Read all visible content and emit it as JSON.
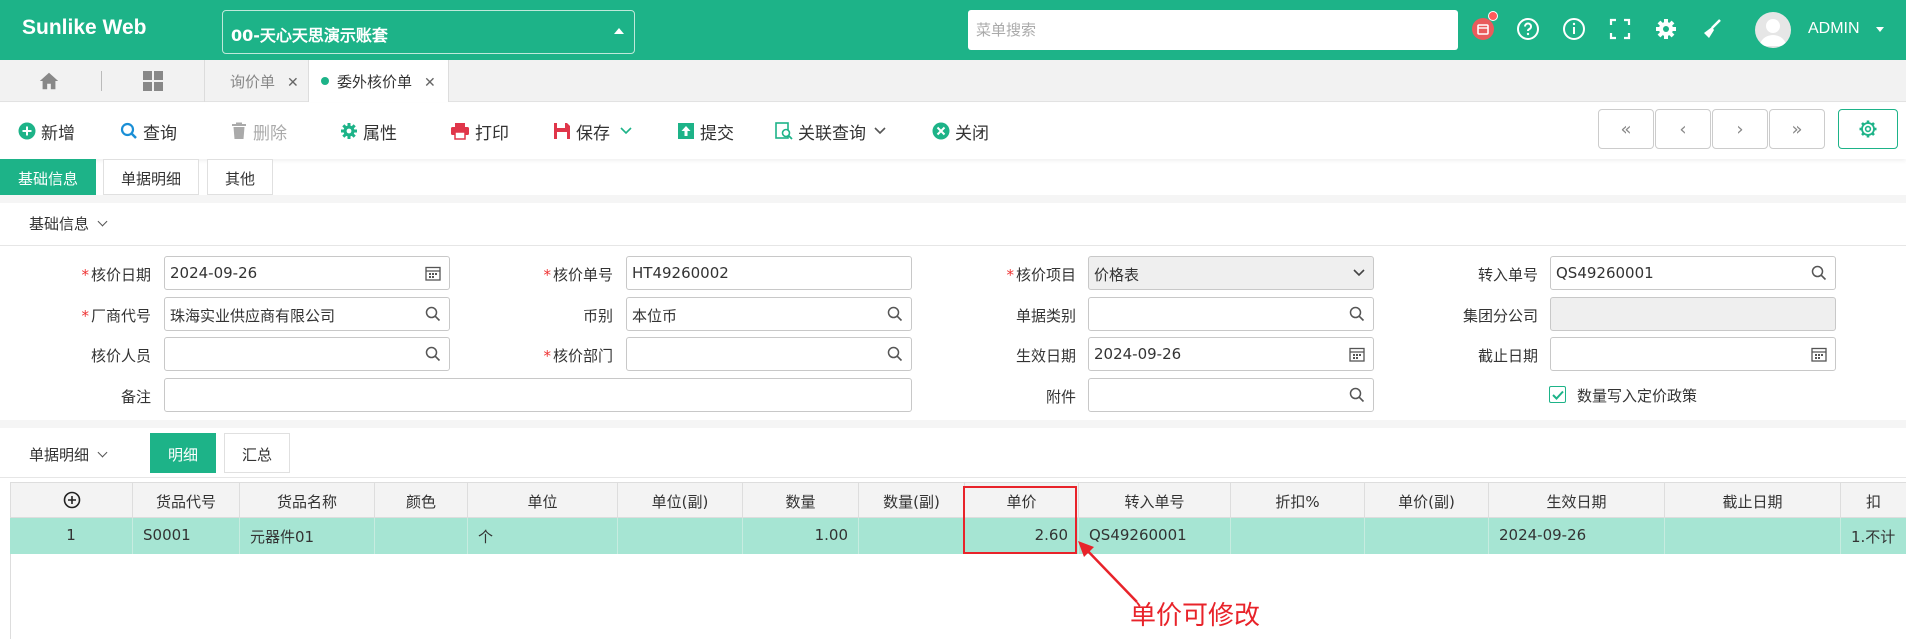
{
  "app": {
    "brand": "Sunlike Web",
    "account": "00-天心天思演示账套",
    "search_placeholder": "菜单搜索",
    "user": "ADMIN"
  },
  "colors": {
    "primary": "#1db388",
    "row_selected": "#a6e5d3",
    "annotation": "#e8232a"
  },
  "page_tabs": [
    {
      "label": "询价单",
      "active": false
    },
    {
      "label": "委外核价单",
      "active": true
    }
  ],
  "toolbar": {
    "add": "新增",
    "query": "查询",
    "delete": "删除",
    "properties": "属性",
    "print": "打印",
    "save": "保存",
    "submit": "提交",
    "related_query": "关联查询",
    "close": "关闭"
  },
  "form_tabs": [
    "基础信息",
    "单据明细",
    "其他"
  ],
  "basic_section_title": "基础信息",
  "fields": {
    "price_date": {
      "label": "核价日期",
      "value": "2024-09-26"
    },
    "price_no": {
      "label": "核价单号",
      "value": "HT49260002"
    },
    "price_item": {
      "label": "核价项目",
      "value": "价格表"
    },
    "transfer_no": {
      "label": "转入单号",
      "value": "QS49260001"
    },
    "vendor_code": {
      "label": "厂商代号",
      "value": "珠海实业供应商有限公司"
    },
    "currency": {
      "label": "币别",
      "value": "本位币"
    },
    "doc_type": {
      "label": "单据类别",
      "value": ""
    },
    "group_branch": {
      "label": "集团分公司",
      "value": ""
    },
    "pricer": {
      "label": "核价人员",
      "value": ""
    },
    "price_dept": {
      "label": "核价部门",
      "value": ""
    },
    "effective_date": {
      "label": "生效日期",
      "value": "2024-09-26"
    },
    "end_date": {
      "label": "截止日期",
      "value": ""
    },
    "remark": {
      "label": "备注",
      "value": ""
    },
    "attachment": {
      "label": "附件",
      "value": ""
    }
  },
  "checkbox_label": "数量写入定价政策",
  "detail_section_title": "单据明细",
  "detail_tabs": [
    "明细",
    "汇总"
  ],
  "grid": {
    "columns": [
      "货品代号",
      "货品名称",
      "颜色",
      "单位",
      "单位(副)",
      "数量",
      "数量(副)",
      "单价",
      "转入单号",
      "折扣%",
      "单价(副)",
      "生效日期",
      "截止日期",
      "扣"
    ],
    "rows": [
      {
        "no": "1",
        "code": "S0001",
        "name": "元器件01",
        "color": "",
        "unit": "个",
        "unit2": "",
        "qty": "1.00",
        "qty2": "",
        "price": "2.60",
        "transfer_no": "QS49260001",
        "discount": "",
        "price2": "",
        "eff_date": "2024-09-26",
        "end_date": "",
        "deduct": "1.不计"
      }
    ]
  },
  "annotation": "单价可修改"
}
